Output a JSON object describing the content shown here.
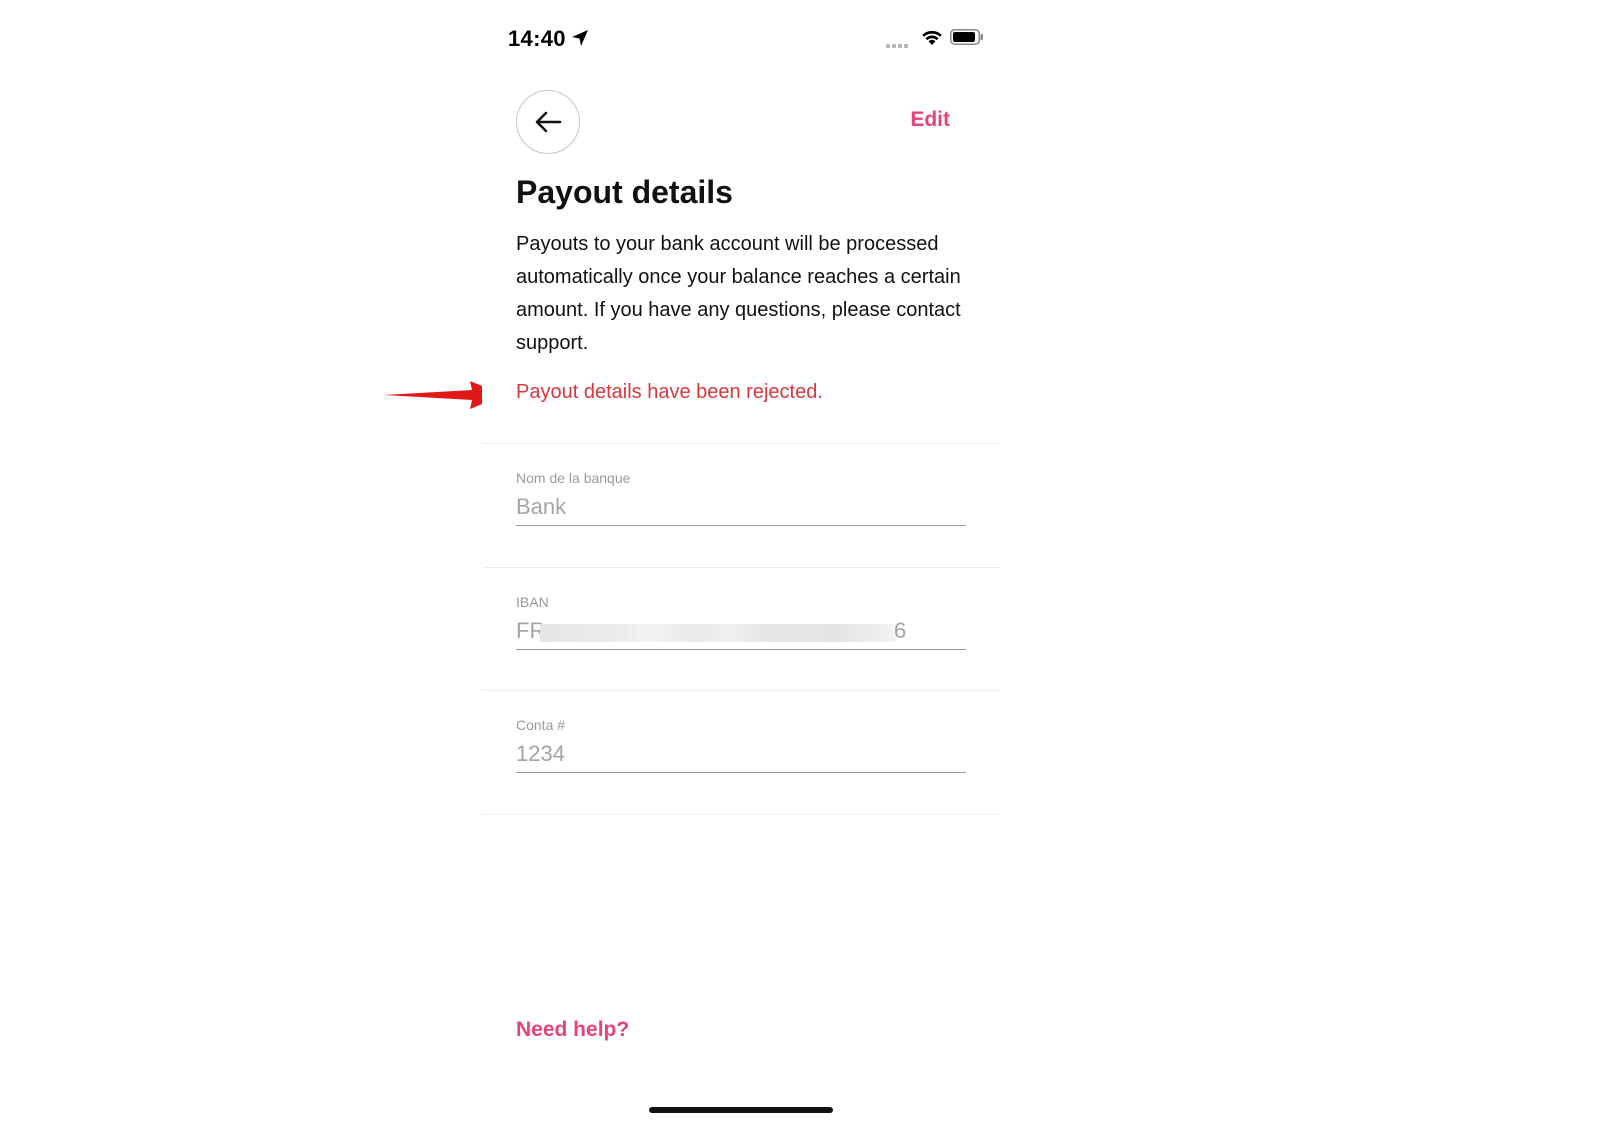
{
  "status_bar": {
    "time": "14:40",
    "location_icon": "location-arrow-icon",
    "signal_icon": "cellular-signal-icon",
    "wifi_icon": "wifi-icon",
    "battery_icon": "battery-icon"
  },
  "header": {
    "back_icon": "arrow-left-icon",
    "edit_label": "Edit"
  },
  "page": {
    "title": "Payout details",
    "description": "Payouts to your bank account will be processed automatically once your balance reaches a certain amount. If you have any questions, please contact support.",
    "error": "Payout details have been rejected."
  },
  "form": {
    "bank": {
      "label": "Nom de la banque",
      "value": "Bank"
    },
    "iban": {
      "label": "IBAN",
      "prefix": "FR",
      "suffix": "6"
    },
    "account": {
      "label": "Conta #",
      "value": "1234"
    }
  },
  "footer": {
    "help_label": "Need help?"
  },
  "colors": {
    "accent": "#e8427a",
    "error": "#d9363e",
    "annotation": "#e11818"
  }
}
